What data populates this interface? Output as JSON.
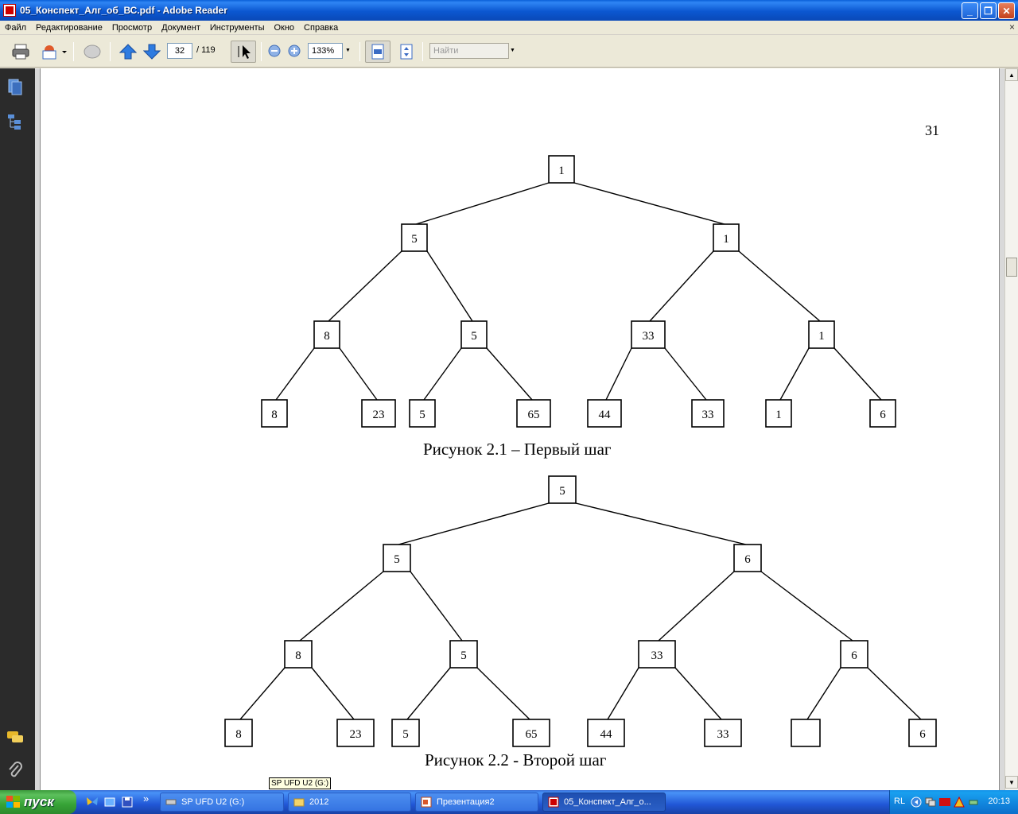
{
  "window": {
    "title": "05_Конспект_Алг_об_ВС.pdf - Adobe Reader",
    "controls": {
      "minimize": "_",
      "restore": "❐",
      "close": "✕"
    }
  },
  "menu": {
    "items": [
      "Файл",
      "Редактирование",
      "Просмотр",
      "Документ",
      "Инструменты",
      "Окно",
      "Справка"
    ],
    "close_glyph": "×"
  },
  "toolbar": {
    "page_current": "32",
    "page_total": "/ 119",
    "zoom": "133%",
    "search_placeholder": "Найти"
  },
  "document": {
    "page_number": "31",
    "figure1": {
      "caption": "Рисунок 2.1 – Первый шаг",
      "levels": [
        [
          "1"
        ],
        [
          "5",
          "1"
        ],
        [
          "8",
          "5",
          "33",
          "1"
        ],
        [
          "8",
          "23",
          "5",
          "65",
          "44",
          "33",
          "1",
          "6"
        ]
      ]
    },
    "figure2": {
      "caption": "Рисунок 2.2 -  Второй шаг",
      "levels": [
        [
          "5"
        ],
        [
          "5",
          "6"
        ],
        [
          "8",
          "5",
          "33",
          "6"
        ],
        [
          "8",
          "23",
          "5",
          "65",
          "44",
          "33",
          "",
          "6"
        ]
      ]
    }
  },
  "tooltip": "SP UFD U2 (G:)",
  "taskbar": {
    "start": "пуск",
    "chevron": "»",
    "tasks": [
      {
        "label": "SP UFD U2 (G:)",
        "icon": "drive-icon"
      },
      {
        "label": "2012",
        "icon": "folder-icon"
      },
      {
        "label": "Презентация2",
        "icon": "powerpoint-icon"
      },
      {
        "label": "05_Конспект_Алг_о...",
        "icon": "pdf-icon",
        "active": true
      }
    ],
    "language": "RL",
    "clock": "20:13"
  },
  "colors": {
    "titlebar": "#0b57d0",
    "taskbar": "#2157d7",
    "start_button": "#36a336",
    "nav_panel": "#2b2b2b"
  }
}
